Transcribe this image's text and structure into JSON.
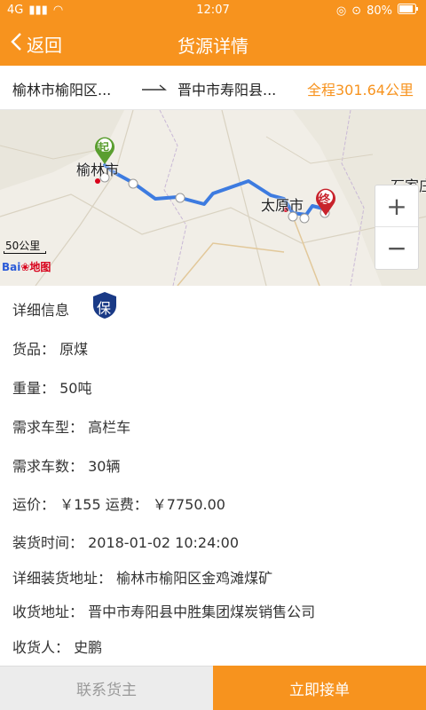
{
  "status_bar": {
    "network": "4G",
    "time": "12:07",
    "battery": "80%"
  },
  "nav": {
    "back_label": "返回",
    "title": "货源详情"
  },
  "route": {
    "from": "榆林市榆阳区...",
    "to": "晋中市寿阳县...",
    "distance": "全程301.64公里"
  },
  "map": {
    "city_start": "榆林市",
    "city_end": "太原市",
    "city_partial": "石家庄",
    "start_marker": "起",
    "end_marker": "终",
    "scale_label": "50公里",
    "logo_text": "Bai",
    "logo_suffix": "地图",
    "zoom_in": "+",
    "zoom_out": "−"
  },
  "details": {
    "section_title": "详细信息",
    "badge": "保",
    "goods": "货品：  原煤",
    "weight": "重量：  50吨",
    "vehicle_type": "需求车型：  高栏车",
    "vehicle_count": "需求车数：  30辆",
    "price": "运价：  ￥155   运费：  ￥7750.00",
    "load_time": "装货时间：  2018-01-02 10:24:00",
    "load_address": "详细装货地址：  榆林市榆阳区金鸡滩煤矿",
    "receive_address": "收货地址：  晋中市寿阳县中胜集团煤炭销售公司",
    "receiver": "收货人：  史鹏"
  },
  "footer": {
    "contact_label": "联系货主",
    "accept_label": "立即接单"
  },
  "colors": {
    "accent": "#f7931e",
    "route_line": "#3d7be0",
    "start_pin": "#5a9e2f",
    "end_pin": "#c8232c",
    "badge": "#1a3a86"
  }
}
